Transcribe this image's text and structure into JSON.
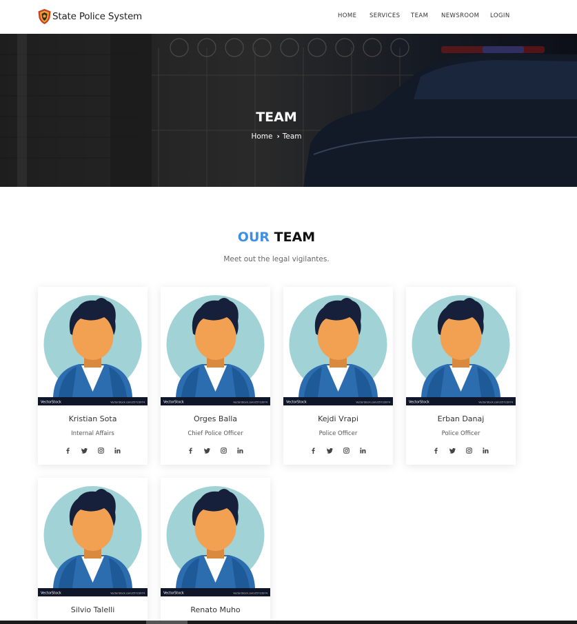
{
  "brand": {
    "name": "State Police System",
    "icon": "police-shield-icon"
  },
  "nav": {
    "items": [
      "HOME",
      "SERVICES",
      "TEAM",
      "NEWSROOM",
      "LOGIN"
    ]
  },
  "hero": {
    "title": "TEAM",
    "breadcrumb": {
      "home": "Home",
      "current": "Team"
    }
  },
  "section": {
    "title_accent": "OUR",
    "title_rest": "TEAM",
    "subtitle": "Meet out the legal vigilantes."
  },
  "colors": {
    "accent": "#3e8fe8",
    "avatar_circle": "#a0d2d6",
    "avatar_shirt": "#2c6db0",
    "avatar_skin": "#f2a153",
    "avatar_hair": "#17203a"
  },
  "photo": {
    "watermark_left": "VectorStock",
    "watermark_right": "VectorStock.com/25723974"
  },
  "team": [
    {
      "name": "Kristian Sota",
      "role": "Internal Affairs"
    },
    {
      "name": "Orges Balla",
      "role": "Chief Police Officer"
    },
    {
      "name": "Kejdi Vrapi",
      "role": "Police Officer"
    },
    {
      "name": "Erban Danaj",
      "role": "Police Officer"
    },
    {
      "name": "Silvio Talelli",
      "role": ""
    },
    {
      "name": "Renato Muho",
      "role": ""
    }
  ],
  "social_icons": [
    "facebook-icon",
    "twitter-icon",
    "instagram-icon",
    "linkedin-icon"
  ]
}
